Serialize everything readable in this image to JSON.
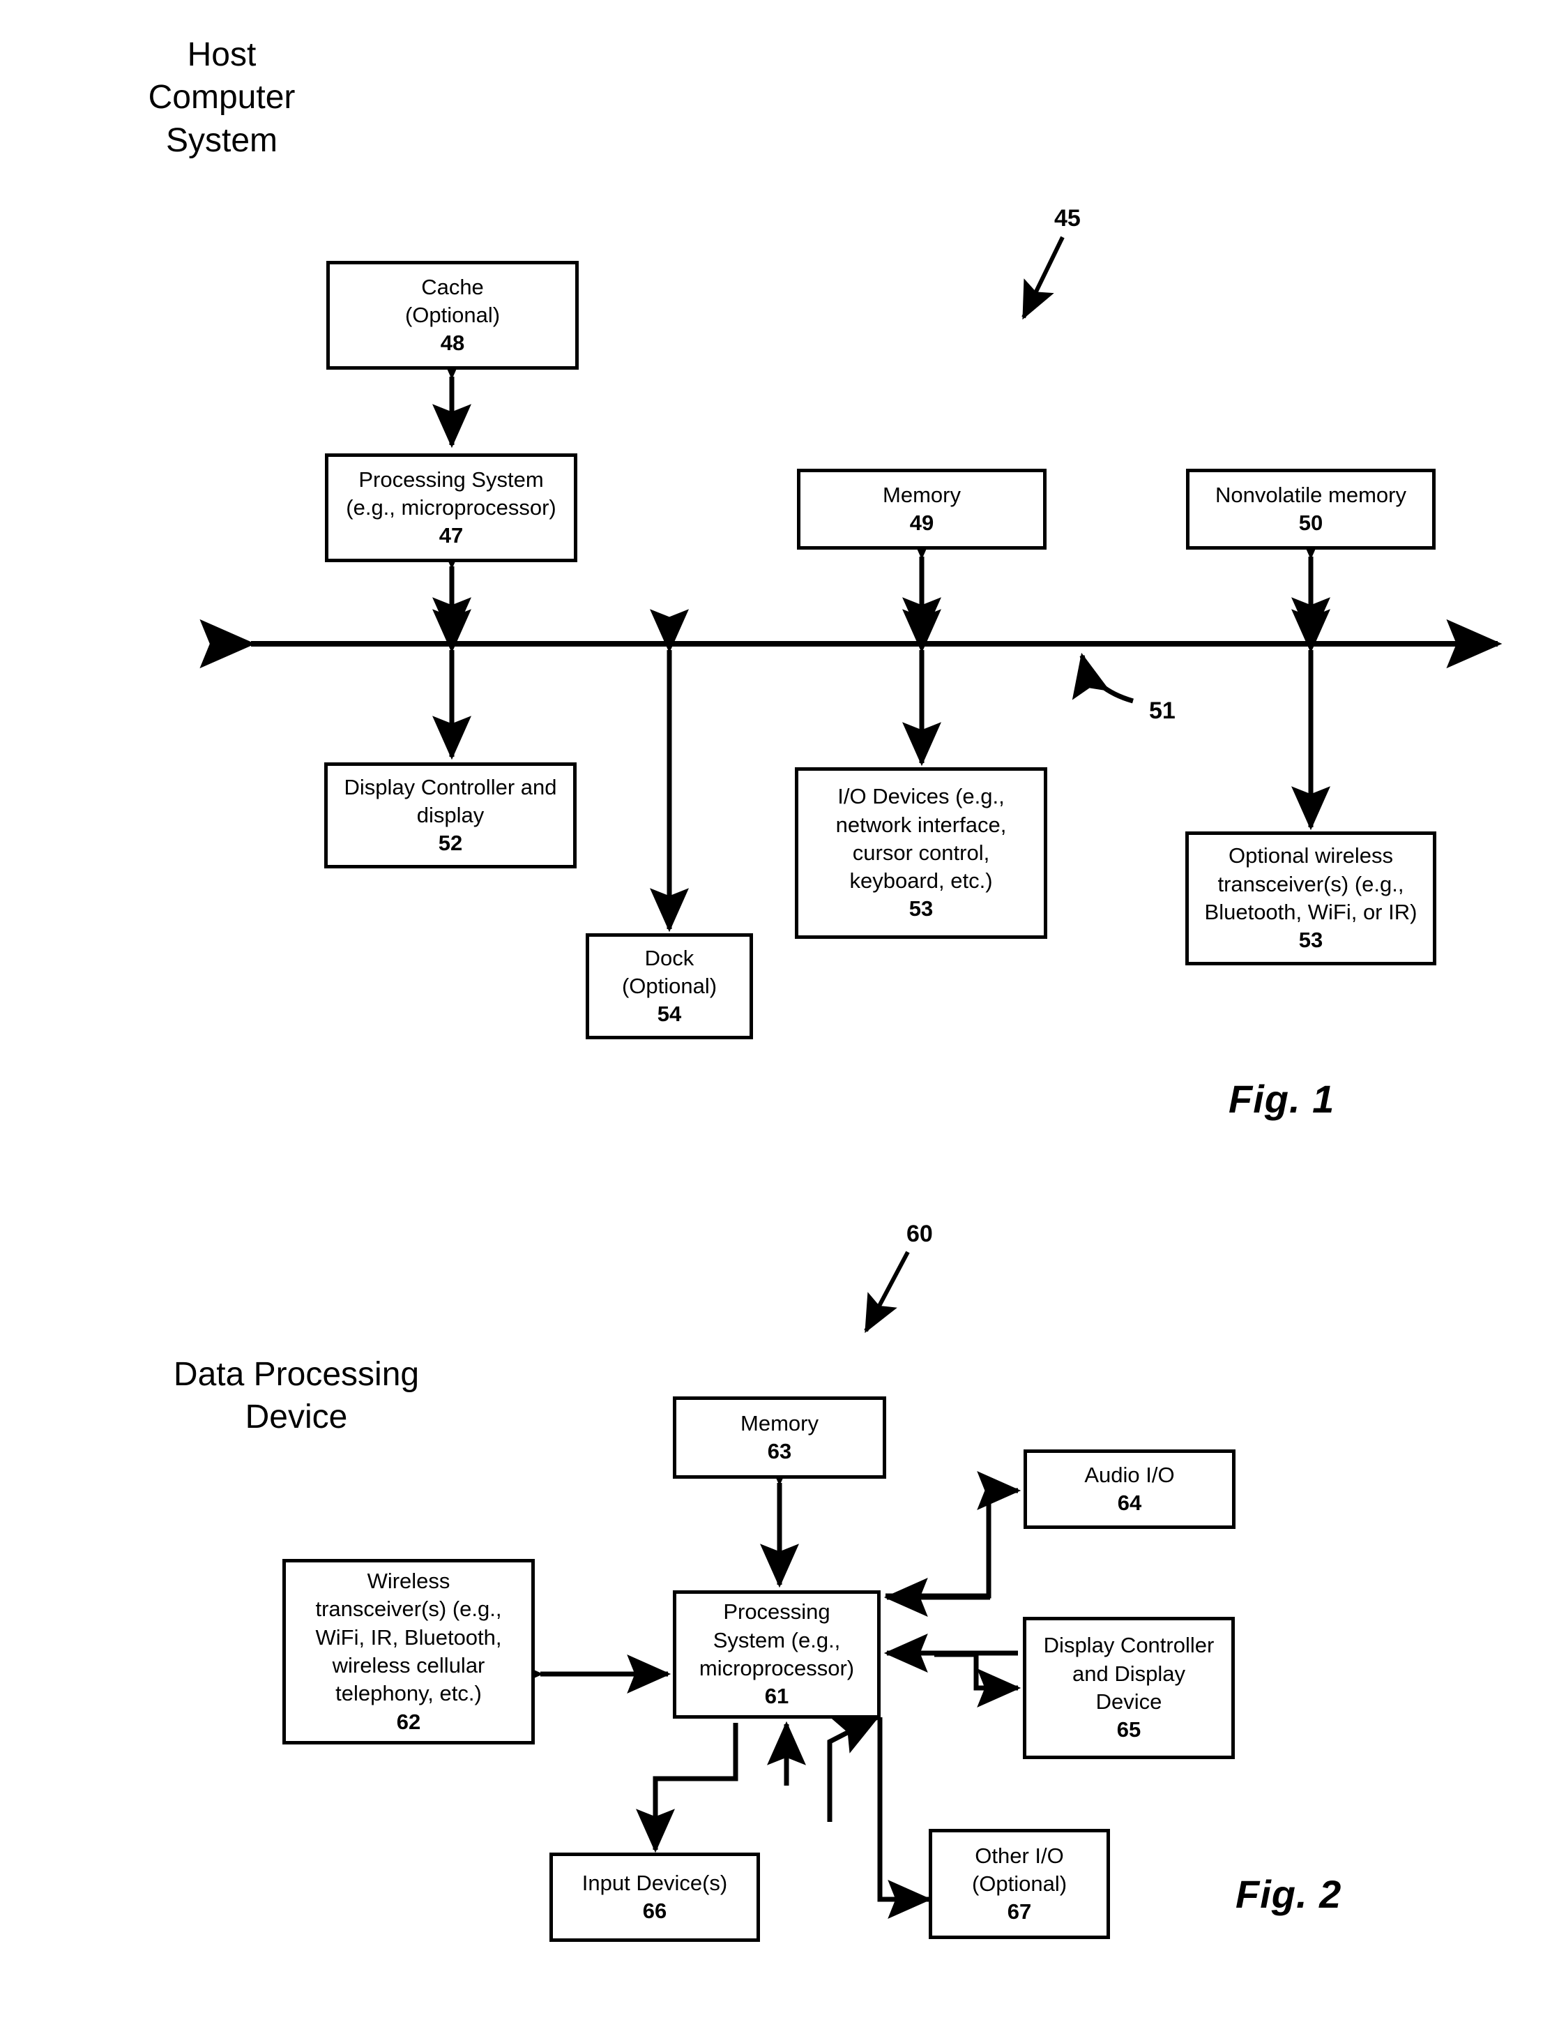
{
  "figure1": {
    "heading": "Host\nComputer\nSystem",
    "ref_label": "45",
    "bus_label": "51",
    "caption": "Fig. 1",
    "boxes": {
      "cache": {
        "lines": [
          "Cache",
          "(Optional)"
        ],
        "num": "48"
      },
      "processing": {
        "lines": [
          "Processing System",
          "(e.g., microprocessor)"
        ],
        "num": "47"
      },
      "memory": {
        "lines": [
          "Memory"
        ],
        "num": "49"
      },
      "nonvolatile": {
        "lines": [
          "Nonvolatile memory"
        ],
        "num": "50"
      },
      "display": {
        "lines": [
          "Display Controller and",
          "display"
        ],
        "num": "52"
      },
      "io_devices": {
        "lines": [
          "I/O Devices (e.g.,",
          "network interface,",
          "cursor control,",
          "keyboard, etc.)"
        ],
        "num": "53"
      },
      "wireless": {
        "lines": [
          "Optional wireless",
          "transceiver(s) (e.g.,",
          "Bluetooth, WiFi, or IR)"
        ],
        "num": "53"
      },
      "dock": {
        "lines": [
          "Dock",
          "(Optional)"
        ],
        "num": "54"
      }
    }
  },
  "figure2": {
    "heading": "Data Processing\nDevice",
    "ref_label": "60",
    "caption": "Fig. 2",
    "boxes": {
      "memory": {
        "lines": [
          "Memory"
        ],
        "num": "63"
      },
      "processing": {
        "lines": [
          "Processing",
          "System (e.g.,",
          "microprocessor)"
        ],
        "num": "61"
      },
      "wireless": {
        "lines": [
          "Wireless",
          "transceiver(s) (e.g.,",
          "WiFi, IR, Bluetooth,",
          "wireless cellular",
          "telephony, etc.)"
        ],
        "num": "62"
      },
      "audio": {
        "lines": [
          "Audio I/O"
        ],
        "num": "64"
      },
      "display": {
        "lines": [
          "Display Controller",
          "and Display",
          "Device"
        ],
        "num": "65"
      },
      "input": {
        "lines": [
          "Input Device(s)"
        ],
        "num": "66"
      },
      "other_io": {
        "lines": [
          "Other I/O",
          "(Optional)"
        ],
        "num": "67"
      }
    }
  },
  "colors": {
    "ink": "#000000",
    "paper": "#ffffff"
  }
}
